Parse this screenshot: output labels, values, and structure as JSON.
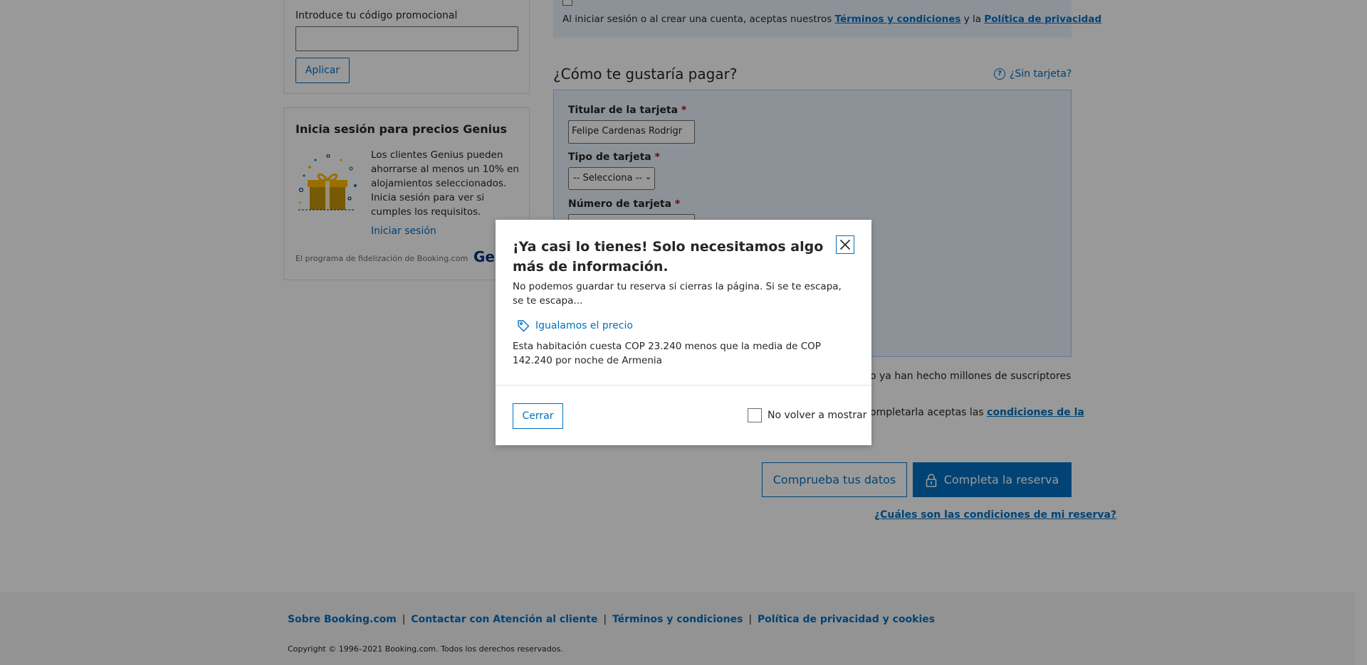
{
  "promo": {
    "label": "Introduce tu código promocional",
    "input_value": "",
    "apply_label": "Aplicar"
  },
  "genius": {
    "title": "Inicia sesión para precios Genius",
    "description": "Los clientes Genius pueden ahorrarse al menos un 10% en alojamientos seleccionados. Inicia sesión para ver si cumples los requisitos.",
    "signin_link": "Iniciar sesión",
    "footer_text": "El programa de fidelización de Booking.com",
    "logo_text": "Genius"
  },
  "terms": {
    "text_before": "Al iniciar sesión o al crear una cuenta, aceptas nuestros ",
    "terms_link": "Términos y condiciones",
    "text_middle": " y la ",
    "privacy_link": "Política de privacidad"
  },
  "payment": {
    "title": "¿Cómo te gustaría pagar?",
    "no_card_link": "¿Sin tarjeta?",
    "holder_label": "Titular de la tarjeta",
    "holder_value": "Felipe Cardenas Rodrigr",
    "type_label": "Tipo de tarjeta",
    "type_value": "-- Selecciona --",
    "number_label": "Número de tarjeta",
    "required_mark": "*"
  },
  "newsletter_fragment": "o ya han hecho millones de suscriptores",
  "conditions_fragment": {
    "text": "ompletarla aceptas las ",
    "link": "condiciones de la"
  },
  "actions": {
    "check_details": "Comprueba tus datos",
    "complete_booking": "Completa la reserva",
    "conditions_link": "¿Cuáles son las condiciones de mi reserva?"
  },
  "footer": {
    "links": [
      "Sobre Booking.com",
      "Contactar con Atención al cliente",
      "Términos y condiciones",
      "Política de privacidad y cookies"
    ],
    "separator": "|",
    "copyright": "Copyright © 1996–2021 Booking.com. Todos los derechos reservados."
  },
  "modal": {
    "title": "¡Ya casi lo tienes! Solo necesitamos algo más de información.",
    "description": "No podemos guardar tu reserva si cierras la página. Si se te escapa, se te escapa...",
    "price_match_label": "Igualamos el precio",
    "price_text": "Esta habitación cuesta COP 23.240 menos que la media de COP 142.240 por noche de Armenia",
    "close_label": "Cerrar",
    "dont_show_label": "No volver a mostrar",
    "dont_show_checked": false
  },
  "icons": {
    "modal_close": "close-icon",
    "price_tag": "tag-icon",
    "no_card": "question-circle-icon",
    "lock": "lock-icon",
    "gift": "gift-icon"
  },
  "colors": {
    "brand_blue": "#0071c2",
    "dark_blue": "#003580",
    "info_bg": "#ebf3ff",
    "required_red": "#cc0000"
  }
}
